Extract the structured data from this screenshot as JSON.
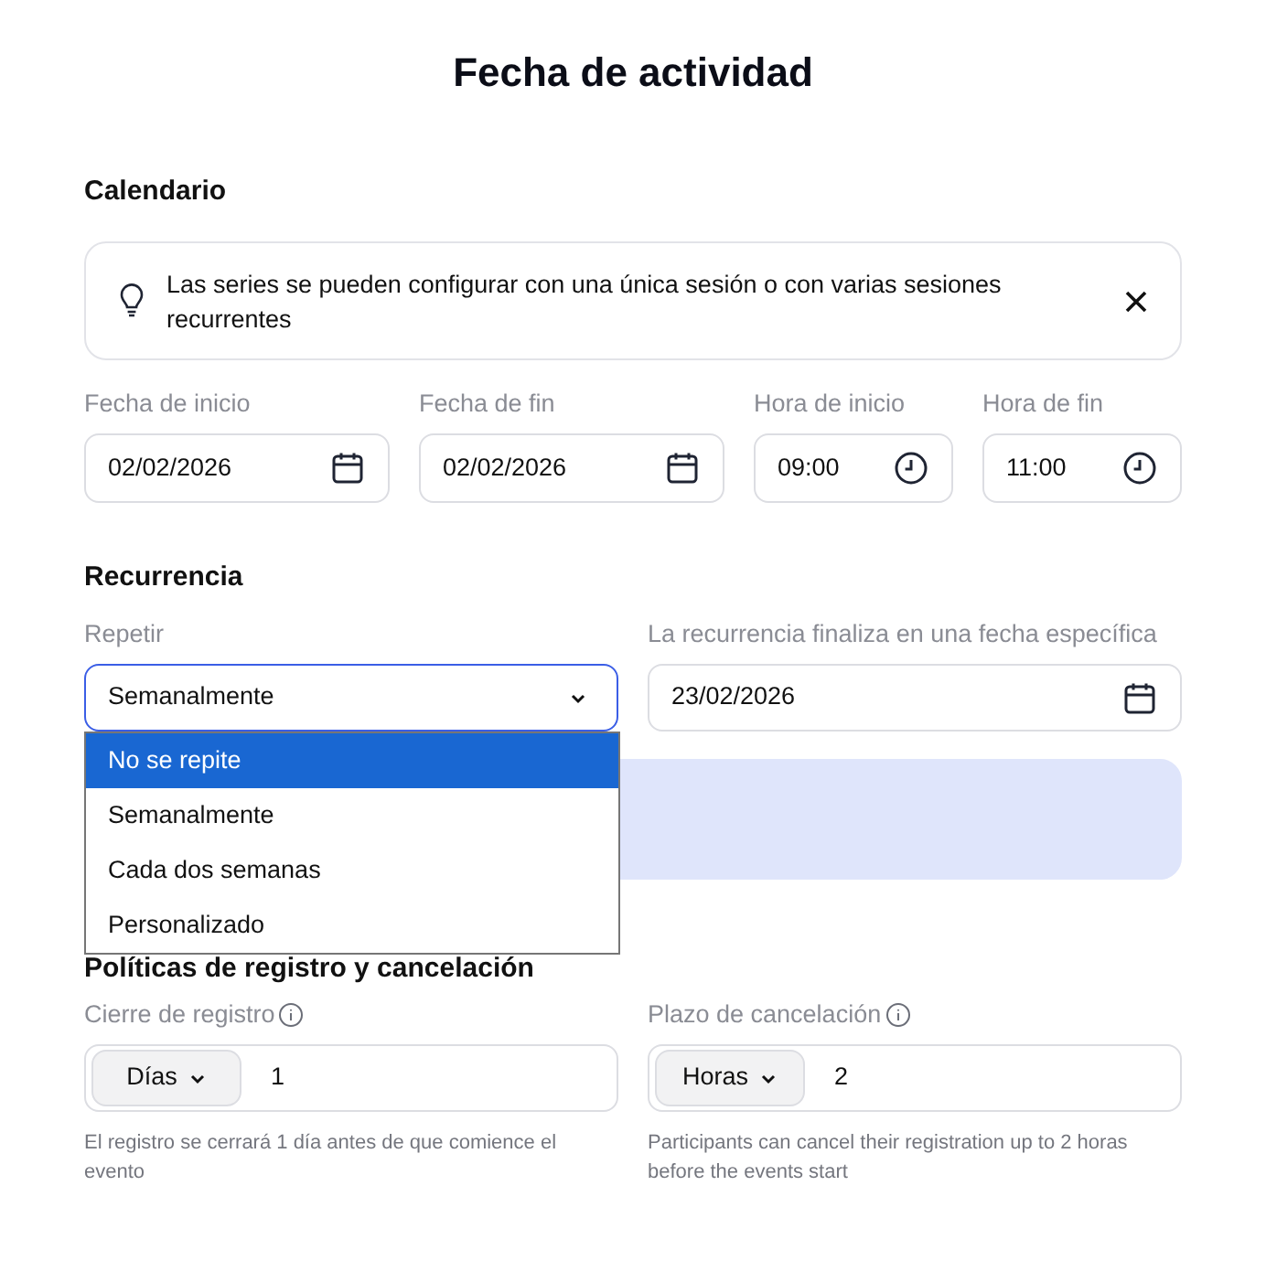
{
  "title": "Fecha de actividad",
  "calendar": {
    "heading": "Calendario",
    "notice": {
      "text": "Las series se pueden configurar con una única sesión o con varias sesiones recurrentes"
    },
    "fields": [
      {
        "label": "Fecha de inicio",
        "value": "02/02/2026",
        "kind": "date"
      },
      {
        "label": "Fecha de fin",
        "value": "02/02/2026",
        "kind": "date"
      },
      {
        "label": "Hora de inicio",
        "value": "09:00",
        "kind": "time"
      },
      {
        "label": "Hora de fin",
        "value": "11:00",
        "kind": "time"
      }
    ]
  },
  "recurrence": {
    "heading": "Recurrencia",
    "repeat": {
      "label": "Repetir",
      "value": "Semanalmente",
      "expanded": true,
      "options": [
        {
          "label": "No se repite",
          "highlighted": true
        },
        {
          "label": "Semanalmente",
          "highlighted": false
        },
        {
          "label": "Cada dos semanas",
          "highlighted": false
        },
        {
          "label": "Personalizado",
          "highlighted": false
        }
      ]
    },
    "end": {
      "label": "La recurrencia finaliza en una fecha específica",
      "value": "23/02/2026"
    }
  },
  "policies": {
    "heading": "Políticas de registro y cancelación",
    "fields": [
      {
        "label": "Cierre de registro",
        "unit": "Días",
        "value": "1",
        "help": "El registro se cerrará 1 día antes de que comience el evento"
      },
      {
        "label": "Plazo de cancelación",
        "unit": "Horas",
        "value": "2",
        "help": "Participants can cancel their registration up to 2 horas before the events start"
      }
    ]
  }
}
